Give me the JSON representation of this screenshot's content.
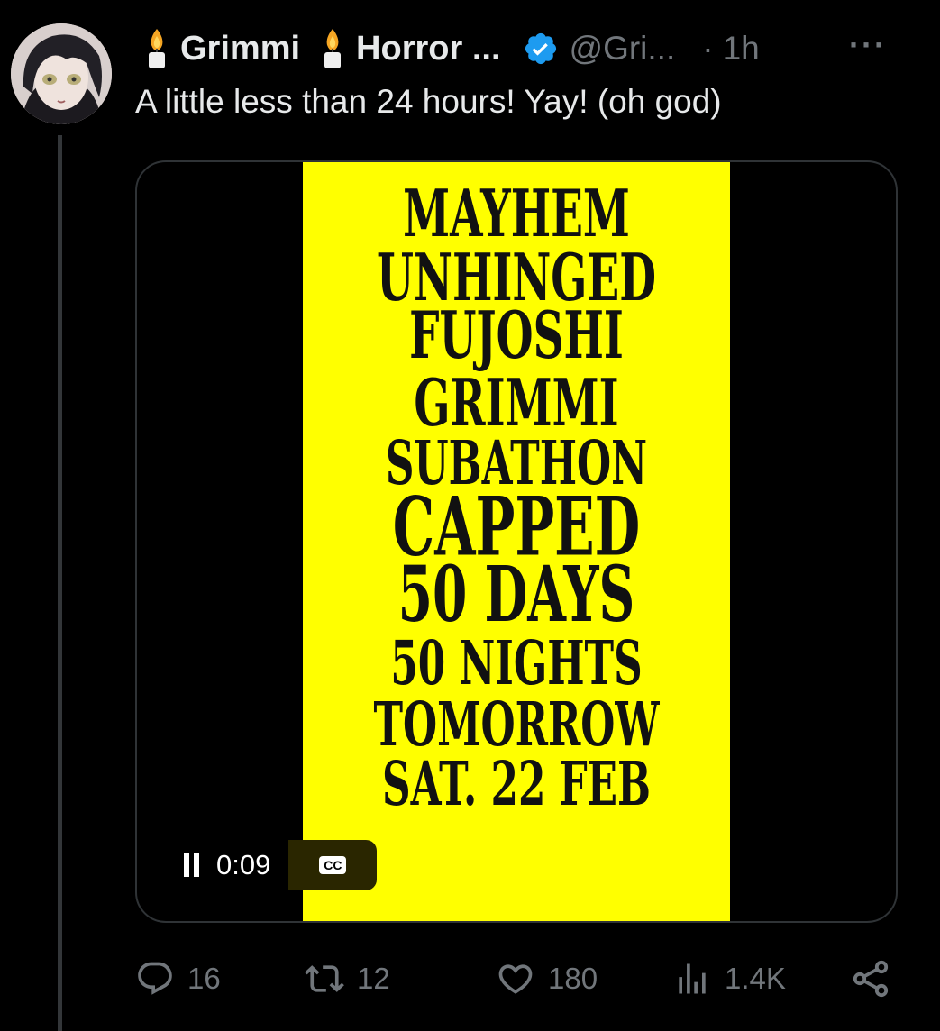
{
  "author": {
    "display_name": "Grimmi",
    "display_name_suffix": "Horror ...",
    "handle": "@Gri...",
    "time_separator": "·",
    "time": "1h",
    "more_label": "···"
  },
  "tweet": {
    "text": "A little less than 24 hours! Yay! (oh god)"
  },
  "media": {
    "poster_lines": [
      "MAYHEM",
      "UNHINGED",
      "FUJOSHI",
      "GRIMMI",
      "SUBATHON",
      "CAPPED",
      "50 DAYS",
      "50 NIGHTS",
      "TOMORROW",
      "SAT. 22 FEB"
    ],
    "poster_color": "#ffff00",
    "timecode": "0:09",
    "cc_label": "CC"
  },
  "actions": {
    "replies": "16",
    "reposts": "12",
    "likes": "180",
    "views": "1.4K"
  },
  "colors": {
    "background": "#000000",
    "text": "#e7e9ea",
    "secondary": "#71767b",
    "verified": "#1d9bf0"
  }
}
